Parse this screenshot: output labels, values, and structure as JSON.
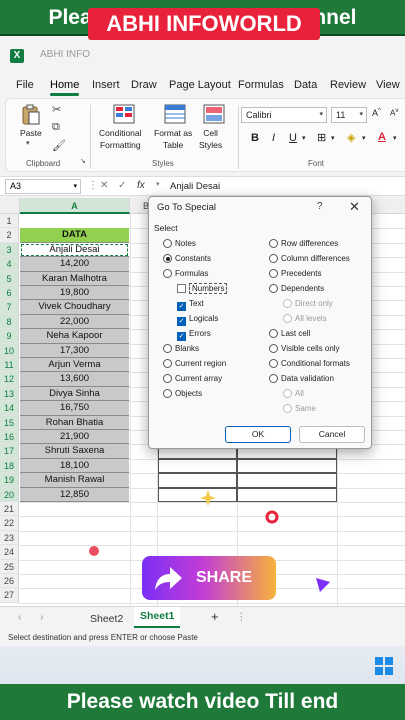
{
  "banner_top": "Please support to Our Channel",
  "banner_bottom": "Please watch video Till end",
  "brand": "ABHI INFOWORLD",
  "file_ghost": "ABHI INFO",
  "menu": [
    "File",
    "Home",
    "Insert",
    "Draw",
    "Page Layout",
    "Formulas",
    "Data",
    "Review",
    "View"
  ],
  "ribbon": {
    "paste": "Paste",
    "clipboard": "Clipboard",
    "conditional": [
      "Conditional",
      "Formatting"
    ],
    "format_table": [
      "Format as",
      "Table"
    ],
    "cell_styles": [
      "Cell",
      "Styles"
    ],
    "styles": "Styles",
    "font_name": "Calibri",
    "font_size": "11",
    "font": "Font",
    "bold": "B",
    "italic": "I",
    "underline": "U"
  },
  "formula_bar": {
    "name_box": "A3",
    "fx": "fx",
    "value": "Anjali Desai"
  },
  "columns": [
    "A",
    "B"
  ],
  "rows": [
    "1",
    "2",
    "3",
    "4",
    "5",
    "6",
    "7",
    "8",
    "9",
    "10",
    "11",
    "12",
    "13",
    "14",
    "15",
    "16",
    "17",
    "18",
    "19",
    "20",
    "21",
    "22",
    "23",
    "24",
    "25",
    "26",
    "27"
  ],
  "data_header": "DATA",
  "data_values": [
    "Anjali Desai",
    "14,200",
    "Karan Malhotra",
    "19,800",
    "Vivek Choudhary",
    "22,000",
    "Neha Kapoor",
    "17,300",
    "Arjun Verma",
    "13,600",
    "Divya Sinha",
    "16,750",
    "Rohan Bhatia",
    "21,900",
    "Shruti Saxena",
    "18,100",
    "Manish Rawal",
    "12,850"
  ],
  "dialog": {
    "title": "Go To Special",
    "help": "?",
    "close": "✕",
    "select_label": "Select",
    "left_options": [
      "Notes",
      "Constants",
      "Formulas",
      "Numbers",
      "Text",
      "Logicals",
      "Errors",
      "Blanks",
      "Current region",
      "Current array",
      "Objects"
    ],
    "right_options": [
      "Row differences",
      "Column differences",
      "Precedents",
      "Dependents",
      "Direct only",
      "All levels",
      "Last cell",
      "Visible cells only",
      "Conditional formats",
      "Data validation",
      "All",
      "Same"
    ],
    "ok": "OK",
    "cancel": "Cancel"
  },
  "share_label": "SHARE",
  "sheet_tabs": [
    "Sheet2",
    "Sheet1"
  ],
  "add_sheet": "+",
  "status_text": "Select destination and press ENTER or choose Paste",
  "colors": {
    "excel_green": "#107c41",
    "banner": "#1f7a3a",
    "brand_red": "#e8223b",
    "header_green": "#92d050",
    "value_gray": "#c9c9c9"
  }
}
